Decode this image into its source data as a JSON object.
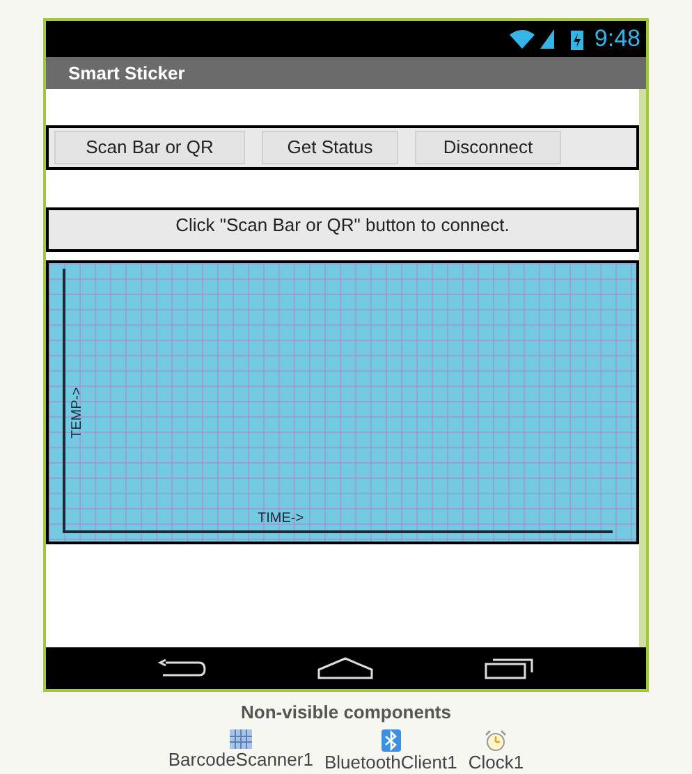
{
  "status_bar": {
    "time": "9:48"
  },
  "title_bar": {
    "title": "Smart Sticker"
  },
  "buttons": [
    "Scan Bar or QR",
    "Get Status",
    "Disconnect"
  ],
  "status_label": "Click \"Scan Bar or QR\" button to connect.",
  "canvas": {
    "ylabel": "TEMP->",
    "xlabel": "TIME->"
  },
  "non_visible": {
    "heading": "Non-visible components",
    "components": [
      {
        "kind": "barcode",
        "name": "BarcodeScanner1"
      },
      {
        "kind": "bluetooth",
        "name": "BluetoothClient1"
      },
      {
        "kind": "clock",
        "name": "Clock1"
      }
    ]
  }
}
